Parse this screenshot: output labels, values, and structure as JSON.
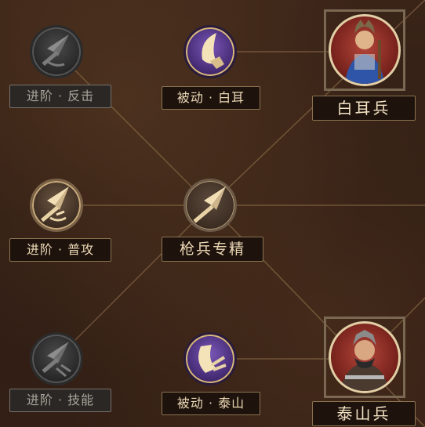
{
  "nodes": {
    "counter": {
      "label": "进阶 · 反击",
      "icon": "spear-icon",
      "state": "locked"
    },
    "normal_attack": {
      "label": "进阶 · 普攻",
      "icon": "spear-icon",
      "state": "unlocked"
    },
    "skill": {
      "label": "进阶 · 技能",
      "icon": "spear-icon",
      "state": "locked"
    },
    "passive_baier": {
      "label": "被动 · 白耳",
      "icon": "horn-icon",
      "state": "unlocked"
    },
    "spear_mastery": {
      "label": "枪兵专精",
      "icon": "spearhead-icon",
      "state": "unlocked"
    },
    "passive_taishan": {
      "label": "被动 · 泰山",
      "icon": "shield-icon",
      "state": "unlocked"
    }
  },
  "units": {
    "baier": {
      "label": "白耳兵",
      "icon": "baier-soldier-portrait"
    },
    "taishan": {
      "label": "泰山兵",
      "icon": "taishan-soldier-portrait"
    }
  },
  "colors": {
    "gold": "#c9aa7a",
    "purple": "#7a57b8",
    "locked": "#4a4a4a",
    "portrait_red": "#b3463a"
  }
}
